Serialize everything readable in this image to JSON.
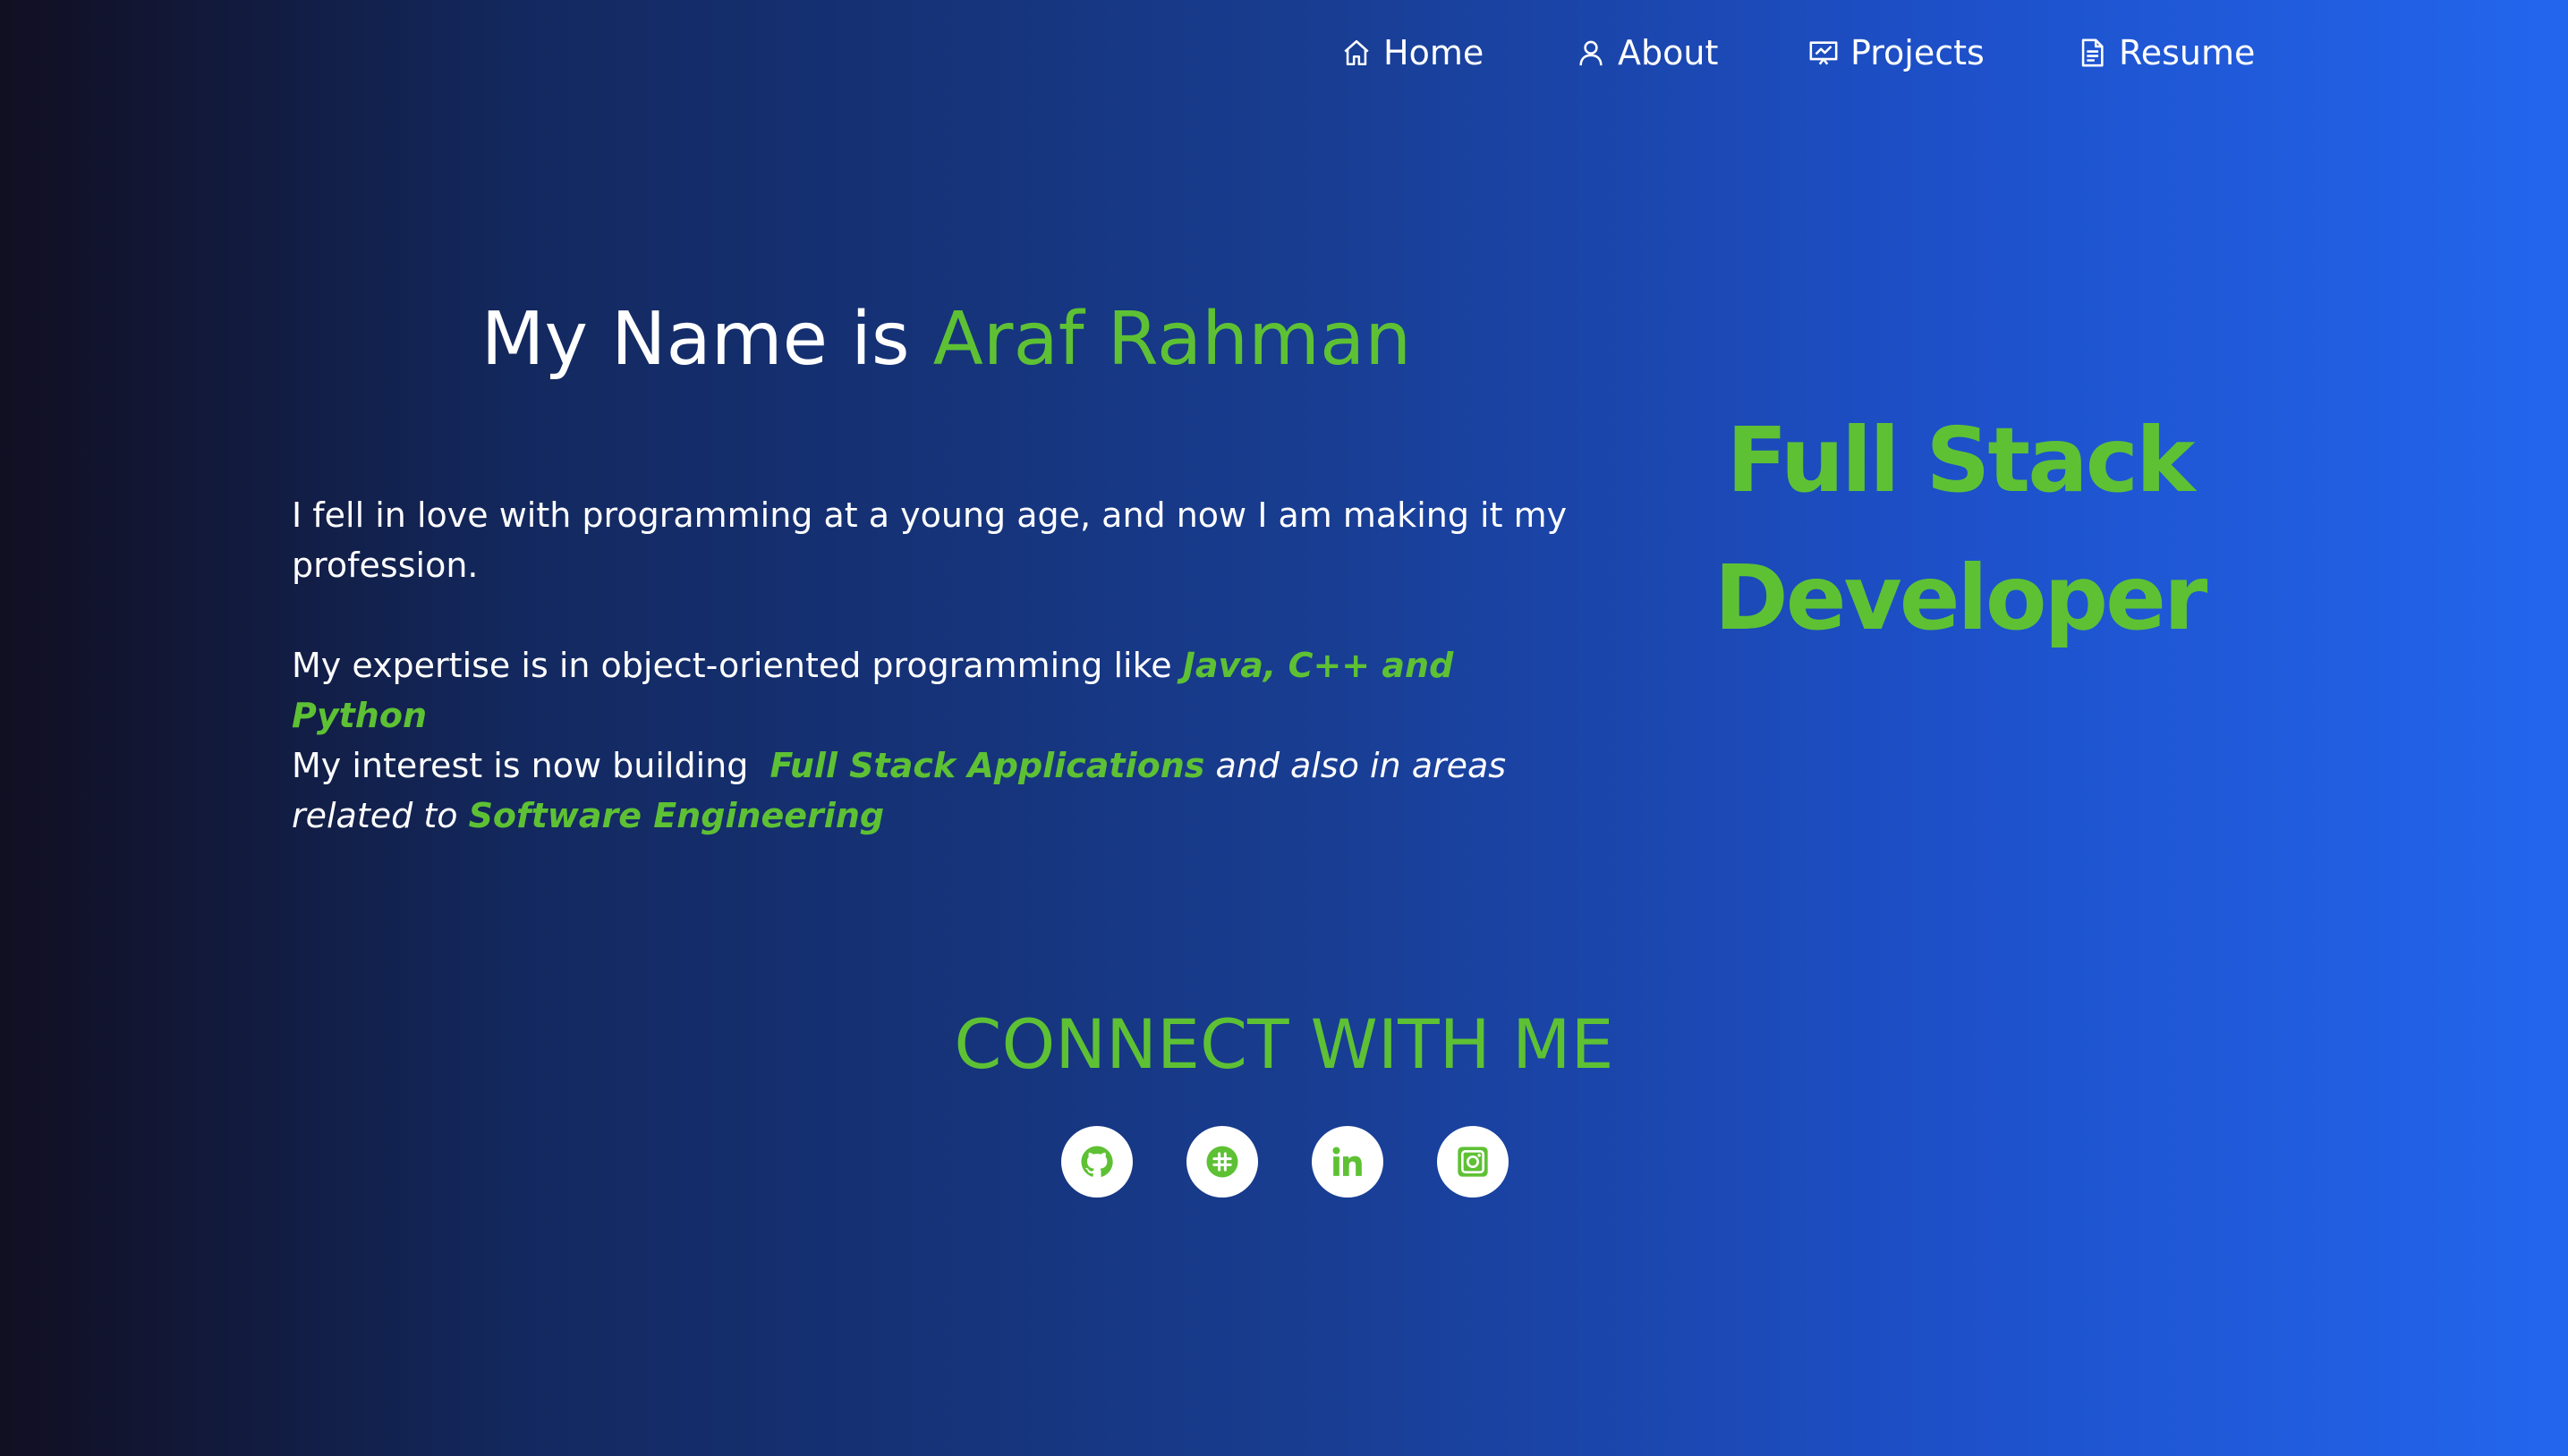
{
  "nav": {
    "items": [
      {
        "label": "Home",
        "icon": "home-icon"
      },
      {
        "label": "About",
        "icon": "user-icon"
      },
      {
        "label": "Projects",
        "icon": "presentation-icon"
      },
      {
        "label": "Resume",
        "icon": "document-icon"
      }
    ]
  },
  "hero": {
    "title_prefix": "My Name is ",
    "name": "Araf Rahman"
  },
  "intro": {
    "p1": "I fell in love with programming at a young age, and now I am making it my profession.",
    "p2_text": "My expertise is in object-oriented programming like ",
    "p2_highlight": "Java, C++ and Python",
    "p3_text": "My interest is now building  ",
    "p3_highlight1": "Full Stack Applications",
    "p3_middle": " and also in areas related to ",
    "p3_highlight2": "Software Engineering"
  },
  "role": {
    "line1": "Full Stack",
    "line2": "Developer"
  },
  "connect": {
    "title": "CONNECT WITH ME",
    "links": [
      {
        "icon": "github-icon"
      },
      {
        "icon": "slack-icon"
      },
      {
        "icon": "linkedin-icon"
      },
      {
        "icon": "instagram-icon"
      }
    ]
  },
  "colors": {
    "accent": "#5ec134",
    "text": "#ffffff",
    "gradient_start": "#110f22",
    "gradient_end": "#2366ee"
  }
}
